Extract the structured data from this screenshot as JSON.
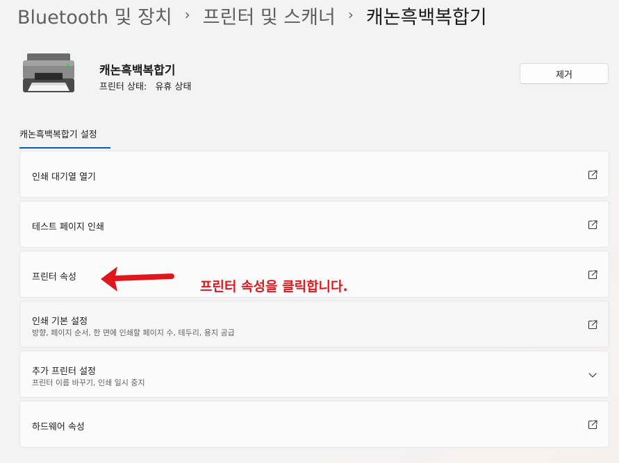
{
  "breadcrumb": {
    "items": [
      "Bluetooth 및 장치",
      "프린터 및 스캐너",
      "캐논흑백복합기"
    ],
    "separator": "›"
  },
  "device": {
    "name": "캐논흑백복합기",
    "status_label": "프린터 상태:",
    "status_value": "유휴 상태",
    "icon": "printer-icon"
  },
  "actions": {
    "remove_label": "제거"
  },
  "section": {
    "tab_label": "캐논흑백복합기 설정",
    "accent_color": "#005fb8"
  },
  "settings": {
    "items": [
      {
        "title": "인쇄 대기열 열기",
        "subtitle": "",
        "icon": "open-external-icon"
      },
      {
        "title": "테스트 페이지 인쇄",
        "subtitle": "",
        "icon": "open-external-icon"
      },
      {
        "title": "프린터 속성",
        "subtitle": "",
        "icon": "open-external-icon"
      },
      {
        "title": "인쇄 기본 설정",
        "subtitle": "방향, 페이지 순서, 한 면에 인쇄할 페이지 수, 테두리, 용지 공급",
        "icon": "open-external-icon"
      },
      {
        "title": "추가 프린터 설정",
        "subtitle": "프린터 이름 바꾸기, 인쇄 일시 중지",
        "icon": "chevron-down-icon"
      },
      {
        "title": "하드웨어 속성",
        "subtitle": "",
        "icon": "open-external-icon"
      }
    ]
  },
  "annotation": {
    "text": "프린터 속성을 클릭합니다.",
    "color": "#e0161b"
  }
}
